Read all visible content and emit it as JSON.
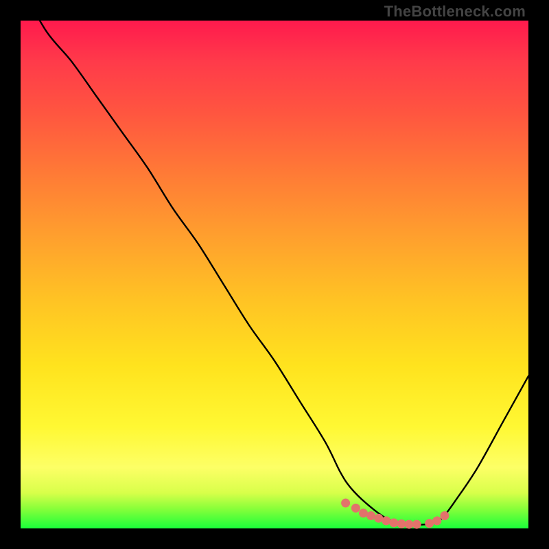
{
  "watermark": "TheBottleneck.com",
  "chart_data": {
    "type": "line",
    "title": "",
    "xlabel": "",
    "ylabel": "",
    "xlim": [
      0,
      100
    ],
    "ylim": [
      0,
      100
    ],
    "series": [
      {
        "name": "bottleneck-curve",
        "x": [
          0,
          5,
          10,
          15,
          20,
          25,
          30,
          35,
          40,
          45,
          50,
          55,
          60,
          63,
          65,
          68,
          72,
          76,
          80,
          81,
          83,
          86,
          90,
          95,
          100
        ],
        "values": [
          107,
          98,
          92,
          85,
          78,
          71,
          63,
          56,
          48,
          40,
          33,
          25,
          17,
          11,
          8,
          5,
          2,
          0.8,
          0.8,
          1,
          2,
          6,
          12,
          21,
          30
        ]
      }
    ],
    "markers": {
      "name": "recommended-range-dots",
      "x": [
        64,
        66,
        67.5,
        69,
        70.5,
        72,
        73.5,
        75,
        76.5,
        78,
        80.5,
        82,
        83.5
      ],
      "values": [
        5,
        4,
        3,
        2.5,
        2,
        1.5,
        1.1,
        0.9,
        0.8,
        0.8,
        1,
        1.5,
        2.5
      ]
    },
    "gradient_stops": [
      {
        "pos": 0,
        "color": "#ff1a4d"
      },
      {
        "pos": 8,
        "color": "#ff3a4a"
      },
      {
        "pos": 18,
        "color": "#ff5540"
      },
      {
        "pos": 30,
        "color": "#ff7a36"
      },
      {
        "pos": 42,
        "color": "#ff9e2e"
      },
      {
        "pos": 55,
        "color": "#ffc324"
      },
      {
        "pos": 68,
        "color": "#ffe31e"
      },
      {
        "pos": 80,
        "color": "#fff833"
      },
      {
        "pos": 88,
        "color": "#fdff66"
      },
      {
        "pos": 93,
        "color": "#d8ff4a"
      },
      {
        "pos": 96,
        "color": "#8bff3a"
      },
      {
        "pos": 100,
        "color": "#1aff3a"
      }
    ]
  }
}
